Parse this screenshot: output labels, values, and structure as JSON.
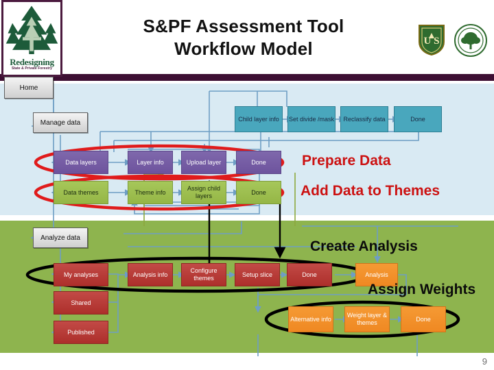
{
  "header": {
    "title_line1": "S&PF Assessment Tool",
    "title_line2": "Workflow Model",
    "logo_line1": "Redesigning",
    "logo_line2": "State & Private Forestry",
    "logo_icon": "pine-tree-icon",
    "seal_fs": "usda-forest-service-shield-icon",
    "seal_nasf": "state-foresters-seal-icon",
    "seal_fs_text": "U S",
    "seal_nasf_text": ""
  },
  "nodes": {
    "home": "Home",
    "manage_data": "Manage data",
    "analyze_data": "Analyze data",
    "child_layer_info": "Child layer info",
    "set_divide_mask": "Set divide /mask",
    "reclassify_data": "Reclassify data",
    "done_teal": "Done",
    "data_layers": "Data layers",
    "layer_info": "Layer info",
    "upload_layer": "Upload layer",
    "done_purple": "Done",
    "data_themes": "Data themes",
    "theme_info": "Theme info",
    "assign_child_layers": "Assign child layers",
    "done_green": "Done",
    "my_analyses": "My analyses",
    "shared": "Shared",
    "published": "Published",
    "analysis_info": "Analysis info",
    "configure_themes": "Configure themes",
    "setup_slice": "Setup slice",
    "done_red": "Done",
    "analysis": "Analysis",
    "alternative_info": "Alternative info",
    "weight_layer_themes": "Weight layer & themes",
    "done_orange": "Done"
  },
  "annotations": {
    "prepare_data": "Prepare Data",
    "add_data_to_themes": "Add Data to Themes",
    "create_analysis": "Create Analysis",
    "assign_weights": "Assign Weights"
  },
  "footer": {
    "page_number": "9"
  },
  "colors": {
    "purple_bar": "#3d0f33",
    "band_blue": "#d9eaf3",
    "band_green": "#8eb44e",
    "teal_node": "#49a7bd",
    "purple_node": "#6d539d",
    "green_node": "#95b646",
    "red_node": "#ad2f2b",
    "orange_node": "#ef8822",
    "annotation_red": "#cc1111",
    "annotation_black": "#0b0b0b",
    "wire": "#6e9ec4"
  }
}
